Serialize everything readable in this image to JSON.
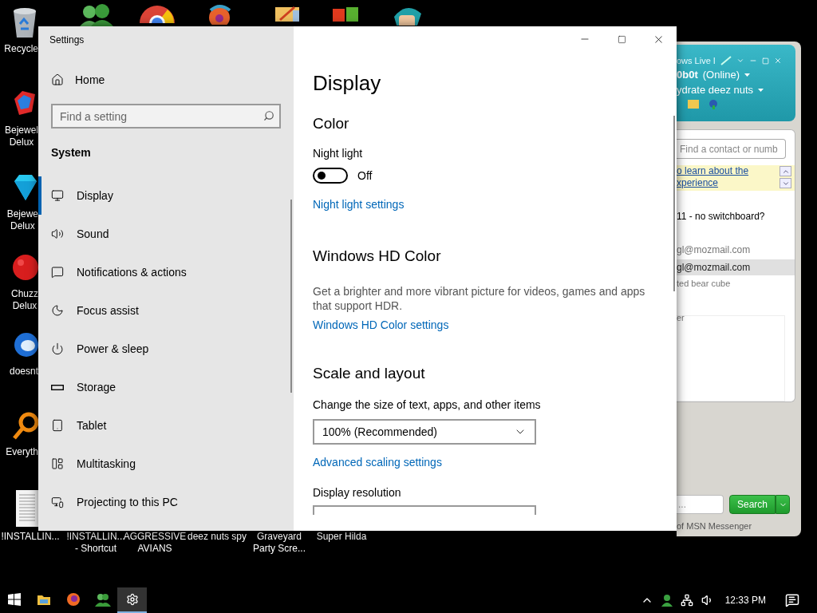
{
  "desktop": {
    "left_icons": [
      {
        "lines": [
          "Recycle"
        ]
      },
      {
        "lines": [
          "Bejewel",
          "Delux"
        ]
      },
      {
        "lines": [
          "Bejewe",
          "Delux"
        ]
      },
      {
        "lines": [
          "Chuzz",
          "Delux"
        ]
      },
      {
        "lines": [
          "doesnt"
        ]
      },
      {
        "lines": [
          "Everyth"
        ]
      }
    ],
    "bottom_icons": [
      {
        "lines": [
          "!INSTALLIN..."
        ]
      },
      {
        "lines": [
          "!INSTALLIN...",
          "- Shortcut"
        ]
      },
      {
        "lines": [
          "AGGRESSIVE",
          "AVIANS"
        ]
      },
      {
        "lines": [
          "deez nuts spy"
        ]
      },
      {
        "lines": [
          "Graveyard",
          "Party Scre..."
        ]
      },
      {
        "lines": [
          "Super Hilda"
        ]
      }
    ]
  },
  "settings_window": {
    "title": "Settings",
    "nav": {
      "home": "Home",
      "search": {
        "placeholder": "Find a setting"
      },
      "section": "System",
      "items": [
        {
          "label": "Display",
          "selected": true
        },
        {
          "label": "Sound",
          "selected": false
        },
        {
          "label": "Notifications & actions",
          "selected": false
        },
        {
          "label": "Focus assist",
          "selected": false
        },
        {
          "label": "Power & sleep",
          "selected": false
        },
        {
          "label": "Storage",
          "selected": false
        },
        {
          "label": "Tablet",
          "selected": false
        },
        {
          "label": "Multitasking",
          "selected": false
        },
        {
          "label": "Projecting to this PC",
          "selected": false
        }
      ]
    },
    "content": {
      "title": "Display",
      "color": {
        "heading": "Color",
        "night_light": {
          "label": "Night light",
          "on": false,
          "state": "Off"
        },
        "link": "Night light settings"
      },
      "hd_color": {
        "heading": "Windows HD Color",
        "description": "Get a brighter and more vibrant picture for videos, games and apps that support HDR.",
        "link": "Windows HD Color settings"
      },
      "scale": {
        "heading": "Scale and layout",
        "size_label": "Change the size of text, apps, and other items",
        "size_value": "100% (Recommended)",
        "link": "Advanced scaling settings",
        "resolution_label": "Display resolution"
      }
    }
  },
  "messenger": {
    "title": "ows Live I",
    "user": "0b0t",
    "status": "(Online)",
    "message": "ydrate deez nuts",
    "search": {
      "placeholder": "Find a contact or numb"
    },
    "banner": [
      "o learn about the",
      "xperience"
    ],
    "contacts": [
      {
        "kind": "group",
        "text": "11 - no switchboard?",
        "selected": false
      },
      {
        "kind": "contact",
        "text": "gl@mozmail.com",
        "selected": false
      },
      {
        "kind": "contact",
        "text": "gl@mozmail.com",
        "selected": true
      },
      {
        "kind": "message",
        "text": "ted bear cube",
        "selected": false
      },
      {
        "kind": "message",
        "text": "er",
        "selected": false
      }
    ],
    "bottom_search": {
      "placeholder": "..."
    },
    "search_button": "Search",
    "status_bar": "of MSN Messenger"
  },
  "taskbar": {
    "apps": [
      {
        "selected": false
      },
      {
        "selected": false
      },
      {
        "selected": false
      },
      {
        "selected": true
      }
    ],
    "clock": "12:33 PM"
  }
}
